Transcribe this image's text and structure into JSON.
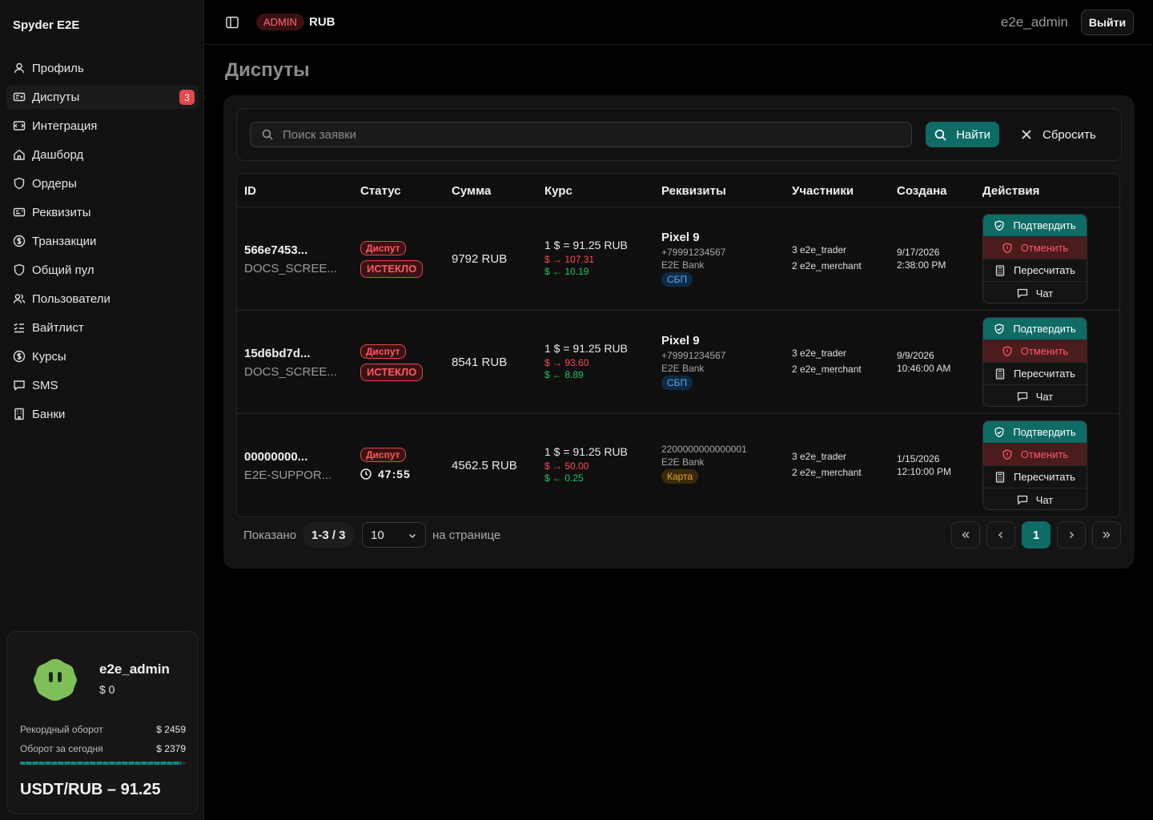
{
  "app": {
    "brand": "Spyder E2E"
  },
  "sidebar": {
    "items": [
      {
        "label": "Профиль",
        "icon": "user-icon"
      },
      {
        "label": "Диспуты",
        "icon": "dispute-icon",
        "badge": "3",
        "active": true
      },
      {
        "label": "Интеграция",
        "icon": "integration-icon"
      },
      {
        "label": "Дашборд",
        "icon": "home-icon"
      },
      {
        "label": "Ордеры",
        "icon": "shield-icon"
      },
      {
        "label": "Реквизиты",
        "icon": "card-icon"
      },
      {
        "label": "Транзакции",
        "icon": "dollar-icon"
      },
      {
        "label": "Общий пул",
        "icon": "shield-icon"
      },
      {
        "label": "Пользователи",
        "icon": "users-icon"
      },
      {
        "label": "Вайтлист",
        "icon": "list-check-icon"
      },
      {
        "label": "Курсы",
        "icon": "dollar-icon"
      },
      {
        "label": "SMS",
        "icon": "message-icon"
      },
      {
        "label": "Банки",
        "icon": "building-icon"
      }
    ]
  },
  "profile": {
    "name": "e2e_admin",
    "balance": "$ 0",
    "record_label": "Рекордный оборот",
    "record_value": "$ 2459",
    "today_label": "Оборот за сегодня",
    "today_value": "$ 2379",
    "turnover_progress": 0.97,
    "rate": "USDT/RUB – 91.25"
  },
  "topbar": {
    "role": "ADMIN",
    "currency": "RUB",
    "username": "e2e_admin",
    "logout_label": "Выйти"
  },
  "page": {
    "title": "Диспуты"
  },
  "search": {
    "placeholder": "Поиск заявки",
    "find_label": "Найти",
    "reset_label": "Сбросить"
  },
  "table": {
    "headers": {
      "id": "ID",
      "status": "Статус",
      "sum": "Сумма",
      "rate": "Курс",
      "requisites": "Реквизиты",
      "participants": "Участники",
      "created": "Создана",
      "actions": "Действия"
    },
    "rows": [
      {
        "id": "566e7453...",
        "ref": "DOCS_SCREE...",
        "status": "Диспут",
        "substatus": "ИСТЕКЛО",
        "sum": "9792 RUB",
        "rate": "1 $ = 91.25 RUB",
        "rate_out": "$ → 107.31",
        "rate_in": "$ ← 10.19",
        "req_name": "Pixel 9",
        "req_number": "+79991234567",
        "req_bank": "E2E Bank",
        "req_method": "СБП",
        "trader": "3 e2e_trader",
        "merchant": "2 e2e_merchant",
        "date": "9/17/2026",
        "time": "2:38:00 PM"
      },
      {
        "id": "15d6bd7d...",
        "ref": "DOCS_SCREE...",
        "status": "Диспут",
        "substatus": "ИСТЕКЛО",
        "sum": "8541 RUB",
        "rate": "1 $ = 91.25 RUB",
        "rate_out": "$ → 93.60",
        "rate_in": "$ ← 8.89",
        "req_name": "Pixel 9",
        "req_number": "+79991234567",
        "req_bank": "E2E Bank",
        "req_method": "СБП",
        "trader": "3 e2e_trader",
        "merchant": "2 e2e_merchant",
        "date": "9/9/2026",
        "time": "10:46:00 AM"
      },
      {
        "id": "00000000...",
        "ref": "E2E-SUPPOR...",
        "status": "Диспут",
        "timer": "47:55",
        "sum": "4562.5 RUB",
        "rate": "1 $ = 91.25 RUB",
        "rate_out": "$ → 50.00",
        "rate_in": "$ ← 0.25",
        "req_number": "2200000000000001",
        "req_bank": "E2E Bank",
        "req_method": "Карта",
        "trader": "3 e2e_trader",
        "merchant": "2 e2e_merchant",
        "date": "1/15/2026",
        "time": "12:10:00 PM"
      }
    ],
    "actions": {
      "confirm": "Подтвердить",
      "cancel": "Отменить",
      "recalc": "Пересчитать",
      "chat": "Чат"
    }
  },
  "pagination": {
    "shown_label": "Показано",
    "range": "1-3 / 3",
    "per_page_value": "10",
    "per_page_label": "на странице",
    "current_page": "1"
  },
  "colors": {
    "accent": "#0e6b66",
    "danger": "#e5484d",
    "success": "#22c55e",
    "amber": "#e0a82e",
    "avatar": "#7fbf5a"
  }
}
